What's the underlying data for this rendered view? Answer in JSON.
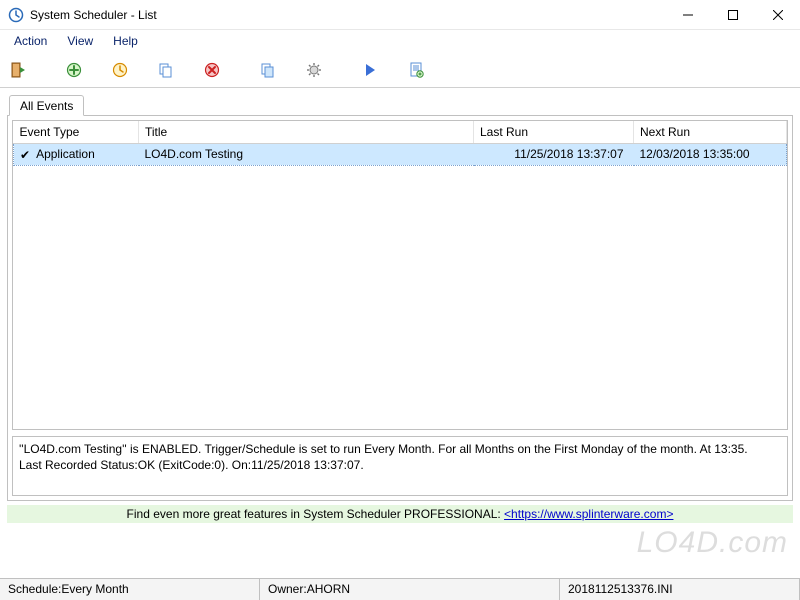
{
  "window": {
    "title": "System Scheduler - List"
  },
  "menu": {
    "action": "Action",
    "view": "View",
    "help": "Help"
  },
  "tabs": {
    "all_events": "All Events"
  },
  "columns": {
    "event_type": "Event Type",
    "title": "Title",
    "last_run": "Last Run",
    "next_run": "Next Run"
  },
  "rows": [
    {
      "event_type": "Application",
      "title": "LO4D.com Testing",
      "last_run": "11/25/2018 13:37:07",
      "next_run": "12/03/2018 13:35:00"
    }
  ],
  "details": {
    "line1": "''LO4D.com Testing'' is ENABLED.  Trigger/Schedule is set to run Every Month.  For all Months on the First Monday of the month.  At 13:35.",
    "line2": "Last Recorded Status:OK (ExitCode:0).  On:11/25/2018 13:37:07."
  },
  "promo": {
    "text_prefix": "Find even more great features in System Scheduler PROFESSIONAL: ",
    "link_text": "<https://www.splinterware.com>"
  },
  "status": {
    "schedule_label": "Schedule:",
    "schedule_value": "Every Month",
    "owner_label": "Owner:",
    "owner_value": "AHORN",
    "filename": "2018112513376.INI"
  },
  "watermark": "LO4D.com",
  "toolbar": {
    "exit": "exit",
    "new_event": "new-event",
    "edit_event": "edit-event",
    "copy_event": "copy-event",
    "delete_event": "delete-event",
    "run_now": "run-now",
    "settings": "settings",
    "play": "play",
    "log": "log"
  }
}
